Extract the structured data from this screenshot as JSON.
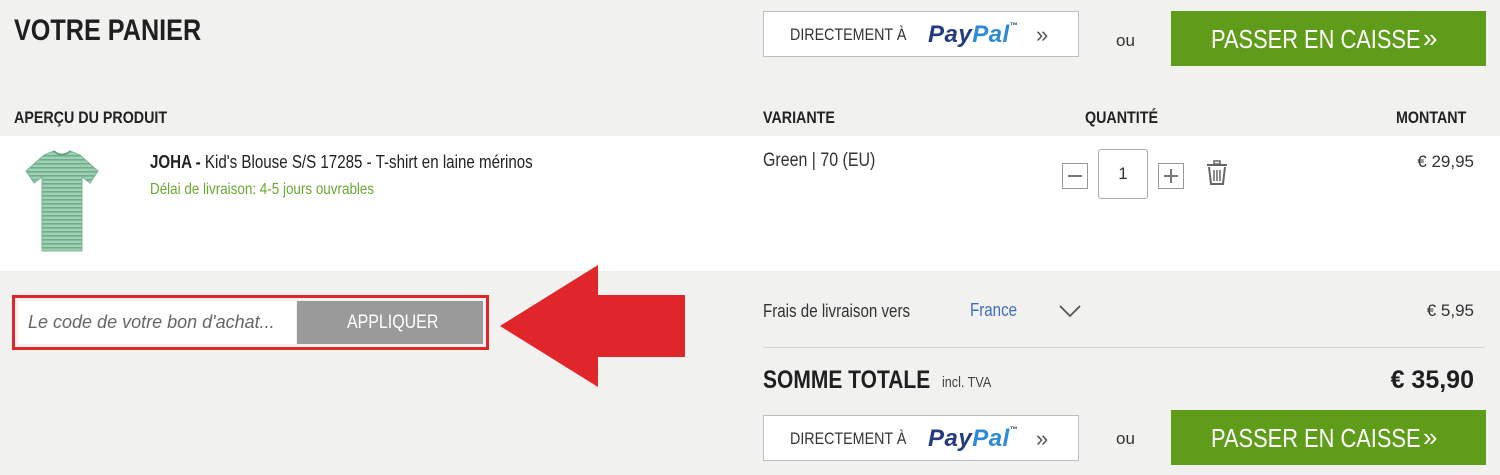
{
  "header": {
    "title": "VOTRE PANIER",
    "paypal": {
      "prefix": "DIRECTEMENT À",
      "logo_a": "Pay",
      "logo_b": "Pal",
      "tm": "™",
      "chevron": "»"
    },
    "or": "ou",
    "checkout": {
      "label": "PASSER EN CAISSE",
      "chevron": "»"
    }
  },
  "columns": {
    "product": "APERÇU DU PRODUIT",
    "variant": "VARIANTE",
    "quantity": "QUANTITÉ",
    "amount": "MONTANT"
  },
  "item": {
    "brand": "JOHA",
    "separator": " - ",
    "name": "Kid's Blouse S/S 17285 - T-shirt en laine mérinos",
    "delivery": "Délai de livraison: 4-5 jours ouvrables",
    "variant": "Green | 70 (EU)",
    "quantity": "1",
    "price": "€ 29,95",
    "thumb_color": "#8cc4a4"
  },
  "voucher": {
    "placeholder": "Le code de votre bon d'achat...",
    "apply_label": "APPLIQUER",
    "highlight_color": "#e1262b"
  },
  "shipping": {
    "label": "Frais de livraison vers",
    "country": "France",
    "price": "€ 5,95"
  },
  "total": {
    "label": "SOMME TOTALE",
    "sub": "incl. TVA",
    "amount": "€ 35,90"
  },
  "footer": {
    "paypal": {
      "prefix": "DIRECTEMENT À",
      "logo_a": "Pay",
      "logo_b": "Pal",
      "tm": "™",
      "chevron": "»"
    },
    "or": "ou",
    "checkout": {
      "label": "PASSER EN CAISSE",
      "chevron": "»"
    }
  },
  "colors": {
    "checkout_green": "#5e9c19",
    "delivery_green": "#6aa832",
    "link_blue": "#3f6dc0",
    "paypal_dark": "#243b80",
    "paypal_light": "#2d8ad6",
    "apply_grey": "#9a9a9a"
  },
  "icons": [
    "chevron-double-right-icon",
    "trash-icon",
    "minus-icon",
    "plus-icon",
    "chevron-down-icon",
    "red-arrow-icon"
  ]
}
